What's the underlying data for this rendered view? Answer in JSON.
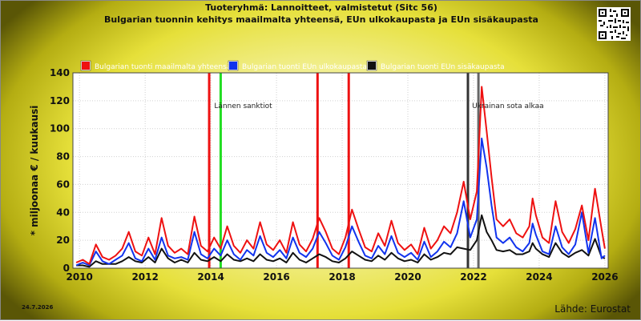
{
  "header": {
    "title_line1": "Tuoteryhmä: Lannoitteet, valmistetut (Sitc 56)",
    "title_line2": "Bulgarian tuonnin kehitys maailmalta yhteensä, EUn ulkokaupasta ja EUn sisäkaupasta"
  },
  "footer": {
    "date": "24.7.2026",
    "source": "Lähde: Eurostat"
  },
  "chart_data": {
    "type": "line",
    "title": "Tuoteryhmä: Lannoitteet, valmistetut (Sitc 56)",
    "subtitle": "Bulgarian tuonnin kehitys maailmalta yhteensä, EUn ulkokaupasta ja EUn sisäkaupasta",
    "xlabel": "",
    "ylabel": "* miljoonaa € / kuukausi",
    "xlim": [
      2009.8,
      2026.1
    ],
    "ylim": [
      0,
      140
    ],
    "xticks": [
      "2010",
      "2012",
      "2014",
      "2016",
      "2018",
      "2020",
      "2022",
      "2024",
      "2026"
    ],
    "yticks": [
      "0",
      "20",
      "40",
      "60",
      "80",
      "100",
      "120",
      "140"
    ],
    "grid": true,
    "legend_position": "top",
    "event_lines": [
      {
        "x": 2013.95,
        "color": "#ee1111",
        "label": ""
      },
      {
        "x": 2014.3,
        "color": "#22dd22",
        "label": "Lännen sanktiot"
      },
      {
        "x": 2017.25,
        "color": "#ee1111",
        "label": ""
      },
      {
        "x": 2018.2,
        "color": "#ee1111",
        "label": ""
      },
      {
        "x": 2021.83,
        "color": "#333333",
        "label": ""
      },
      {
        "x": 2022.15,
        "color": "#666666",
        "label": "Ukrainan sota alkaa"
      }
    ],
    "series": [
      {
        "name": "Bulgarian tuonti maailmalta yhteensä",
        "color": "#ee1111",
        "points": [
          [
            2009.9,
            4
          ],
          [
            2010.1,
            6
          ],
          [
            2010.3,
            3
          ],
          [
            2010.5,
            17
          ],
          [
            2010.7,
            8
          ],
          [
            2010.9,
            6
          ],
          [
            2011.1,
            9
          ],
          [
            2011.3,
            14
          ],
          [
            2011.5,
            26
          ],
          [
            2011.7,
            12
          ],
          [
            2011.9,
            9
          ],
          [
            2012.1,
            22
          ],
          [
            2012.3,
            10
          ],
          [
            2012.5,
            36
          ],
          [
            2012.7,
            16
          ],
          [
            2012.9,
            11
          ],
          [
            2013.1,
            14
          ],
          [
            2013.3,
            10
          ],
          [
            2013.5,
            37
          ],
          [
            2013.7,
            16
          ],
          [
            2013.9,
            12
          ],
          [
            2014.1,
            22
          ],
          [
            2014.3,
            14
          ],
          [
            2014.5,
            30
          ],
          [
            2014.7,
            16
          ],
          [
            2014.9,
            11
          ],
          [
            2015.1,
            20
          ],
          [
            2015.3,
            14
          ],
          [
            2015.5,
            33
          ],
          [
            2015.7,
            17
          ],
          [
            2015.9,
            13
          ],
          [
            2016.1,
            20
          ],
          [
            2016.3,
            11
          ],
          [
            2016.5,
            33
          ],
          [
            2016.7,
            17
          ],
          [
            2016.9,
            12
          ],
          [
            2017.1,
            21
          ],
          [
            2017.3,
            36
          ],
          [
            2017.5,
            26
          ],
          [
            2017.7,
            14
          ],
          [
            2017.9,
            10
          ],
          [
            2018.1,
            22
          ],
          [
            2018.3,
            42
          ],
          [
            2018.5,
            28
          ],
          [
            2018.7,
            15
          ],
          [
            2018.9,
            12
          ],
          [
            2019.1,
            25
          ],
          [
            2019.3,
            16
          ],
          [
            2019.5,
            34
          ],
          [
            2019.7,
            18
          ],
          [
            2019.9,
            13
          ],
          [
            2020.1,
            17
          ],
          [
            2020.3,
            10
          ],
          [
            2020.5,
            29
          ],
          [
            2020.7,
            14
          ],
          [
            2020.9,
            20
          ],
          [
            2021.1,
            30
          ],
          [
            2021.3,
            25
          ],
          [
            2021.5,
            40
          ],
          [
            2021.7,
            62
          ],
          [
            2021.9,
            35
          ],
          [
            2022.1,
            55
          ],
          [
            2022.25,
            130
          ],
          [
            2022.4,
            98
          ],
          [
            2022.55,
            65
          ],
          [
            2022.7,
            35
          ],
          [
            2022.9,
            30
          ],
          [
            2023.1,
            35
          ],
          [
            2023.3,
            25
          ],
          [
            2023.5,
            22
          ],
          [
            2023.7,
            30
          ],
          [
            2023.8,
            50
          ],
          [
            2023.9,
            38
          ],
          [
            2024.1,
            22
          ],
          [
            2024.3,
            18
          ],
          [
            2024.5,
            48
          ],
          [
            2024.7,
            26
          ],
          [
            2024.9,
            18
          ],
          [
            2025.1,
            28
          ],
          [
            2025.3,
            45
          ],
          [
            2025.5,
            20
          ],
          [
            2025.7,
            57
          ],
          [
            2025.9,
            28
          ],
          [
            2026.0,
            14
          ]
        ]
      },
      {
        "name": "Bulgarian tuonti EUn ulkokaupasta",
        "color": "#1133ee",
        "points": [
          [
            2009.9,
            2
          ],
          [
            2010.1,
            4
          ],
          [
            2010.3,
            2
          ],
          [
            2010.5,
            12
          ],
          [
            2010.7,
            5
          ],
          [
            2010.9,
            3
          ],
          [
            2011.1,
            6
          ],
          [
            2011.3,
            9
          ],
          [
            2011.5,
            18
          ],
          [
            2011.7,
            7
          ],
          [
            2011.9,
            5
          ],
          [
            2012.1,
            14
          ],
          [
            2012.3,
            6
          ],
          [
            2012.5,
            22
          ],
          [
            2012.7,
            9
          ],
          [
            2012.9,
            7
          ],
          [
            2013.1,
            8
          ],
          [
            2013.3,
            6
          ],
          [
            2013.5,
            26
          ],
          [
            2013.7,
            10
          ],
          [
            2013.9,
            7
          ],
          [
            2014.1,
            14
          ],
          [
            2014.3,
            9
          ],
          [
            2014.5,
            20
          ],
          [
            2014.7,
            10
          ],
          [
            2014.9,
            6
          ],
          [
            2015.1,
            13
          ],
          [
            2015.3,
            9
          ],
          [
            2015.5,
            23
          ],
          [
            2015.7,
            11
          ],
          [
            2015.9,
            8
          ],
          [
            2016.1,
            13
          ],
          [
            2016.3,
            7
          ],
          [
            2016.5,
            22
          ],
          [
            2016.7,
            11
          ],
          [
            2016.9,
            8
          ],
          [
            2017.1,
            14
          ],
          [
            2017.3,
            26
          ],
          [
            2017.5,
            18
          ],
          [
            2017.7,
            9
          ],
          [
            2017.9,
            6
          ],
          [
            2018.1,
            15
          ],
          [
            2018.3,
            30
          ],
          [
            2018.5,
            19
          ],
          [
            2018.7,
            9
          ],
          [
            2018.9,
            7
          ],
          [
            2019.1,
            16
          ],
          [
            2019.3,
            10
          ],
          [
            2019.5,
            23
          ],
          [
            2019.7,
            11
          ],
          [
            2019.9,
            8
          ],
          [
            2020.1,
            11
          ],
          [
            2020.3,
            6
          ],
          [
            2020.5,
            19
          ],
          [
            2020.7,
            8
          ],
          [
            2020.9,
            12
          ],
          [
            2021.1,
            19
          ],
          [
            2021.3,
            15
          ],
          [
            2021.5,
            25
          ],
          [
            2021.7,
            48
          ],
          [
            2021.9,
            22
          ],
          [
            2022.1,
            35
          ],
          [
            2022.25,
            93
          ],
          [
            2022.4,
            72
          ],
          [
            2022.55,
            45
          ],
          [
            2022.7,
            22
          ],
          [
            2022.9,
            18
          ],
          [
            2023.1,
            22
          ],
          [
            2023.3,
            15
          ],
          [
            2023.5,
            12
          ],
          [
            2023.7,
            18
          ],
          [
            2023.8,
            32
          ],
          [
            2023.9,
            24
          ],
          [
            2024.1,
            12
          ],
          [
            2024.3,
            10
          ],
          [
            2024.5,
            30
          ],
          [
            2024.7,
            15
          ],
          [
            2024.9,
            10
          ],
          [
            2025.1,
            17
          ],
          [
            2025.3,
            40
          ],
          [
            2025.5,
            11
          ],
          [
            2025.7,
            36
          ],
          [
            2025.9,
            7
          ],
          [
            2026.0,
            9
          ]
        ]
      },
      {
        "name": "Bulgarian tuonti EUn sisäkaupasta",
        "color": "#111111",
        "points": [
          [
            2009.9,
            2
          ],
          [
            2010.1,
            2
          ],
          [
            2010.3,
            1
          ],
          [
            2010.5,
            5
          ],
          [
            2010.7,
            3
          ],
          [
            2010.9,
            3
          ],
          [
            2011.1,
            3
          ],
          [
            2011.3,
            5
          ],
          [
            2011.5,
            8
          ],
          [
            2011.7,
            5
          ],
          [
            2011.9,
            4
          ],
          [
            2012.1,
            8
          ],
          [
            2012.3,
            4
          ],
          [
            2012.5,
            14
          ],
          [
            2012.7,
            7
          ],
          [
            2012.9,
            4
          ],
          [
            2013.1,
            6
          ],
          [
            2013.3,
            4
          ],
          [
            2013.5,
            11
          ],
          [
            2013.7,
            6
          ],
          [
            2013.9,
            5
          ],
          [
            2014.1,
            8
          ],
          [
            2014.3,
            5
          ],
          [
            2014.5,
            10
          ],
          [
            2014.7,
            6
          ],
          [
            2014.9,
            5
          ],
          [
            2015.1,
            7
          ],
          [
            2015.3,
            5
          ],
          [
            2015.5,
            10
          ],
          [
            2015.7,
            6
          ],
          [
            2015.9,
            5
          ],
          [
            2016.1,
            7
          ],
          [
            2016.3,
            4
          ],
          [
            2016.5,
            11
          ],
          [
            2016.7,
            6
          ],
          [
            2016.9,
            4
          ],
          [
            2017.1,
            7
          ],
          [
            2017.3,
            10
          ],
          [
            2017.5,
            8
          ],
          [
            2017.7,
            5
          ],
          [
            2017.9,
            4
          ],
          [
            2018.1,
            7
          ],
          [
            2018.3,
            12
          ],
          [
            2018.5,
            9
          ],
          [
            2018.7,
            6
          ],
          [
            2018.9,
            5
          ],
          [
            2019.1,
            9
          ],
          [
            2019.3,
            6
          ],
          [
            2019.5,
            11
          ],
          [
            2019.7,
            7
          ],
          [
            2019.9,
            5
          ],
          [
            2020.1,
            6
          ],
          [
            2020.3,
            4
          ],
          [
            2020.5,
            10
          ],
          [
            2020.7,
            6
          ],
          [
            2020.9,
            8
          ],
          [
            2021.1,
            11
          ],
          [
            2021.3,
            10
          ],
          [
            2021.5,
            15
          ],
          [
            2021.7,
            14
          ],
          [
            2021.9,
            13
          ],
          [
            2022.1,
            20
          ],
          [
            2022.25,
            38
          ],
          [
            2022.4,
            26
          ],
          [
            2022.55,
            20
          ],
          [
            2022.7,
            13
          ],
          [
            2022.9,
            12
          ],
          [
            2023.1,
            13
          ],
          [
            2023.3,
            10
          ],
          [
            2023.5,
            10
          ],
          [
            2023.7,
            12
          ],
          [
            2023.8,
            18
          ],
          [
            2023.9,
            14
          ],
          [
            2024.1,
            10
          ],
          [
            2024.3,
            8
          ],
          [
            2024.5,
            18
          ],
          [
            2024.7,
            11
          ],
          [
            2024.9,
            8
          ],
          [
            2025.1,
            11
          ],
          [
            2025.3,
            13
          ],
          [
            2025.5,
            9
          ],
          [
            2025.7,
            21
          ],
          [
            2025.9,
            8
          ],
          [
            2026.0,
            7
          ]
        ]
      }
    ]
  }
}
